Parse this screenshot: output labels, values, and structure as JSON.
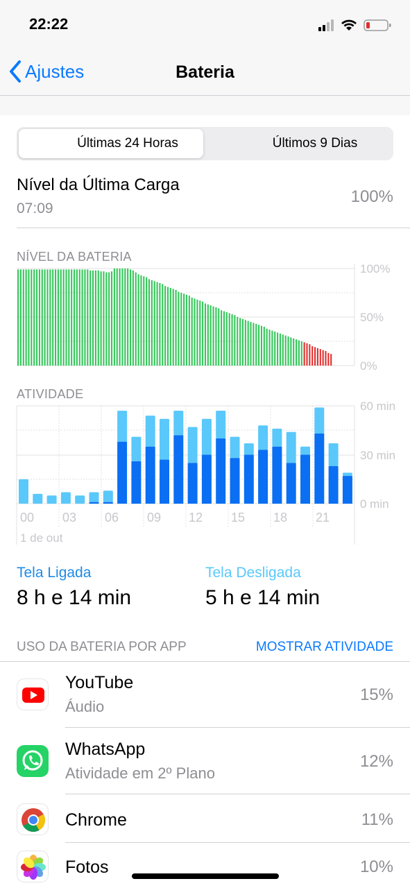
{
  "status_bar": {
    "time": "22:22"
  },
  "nav": {
    "back_label": "Ajustes",
    "title": "Bateria"
  },
  "segment": {
    "options": [
      "Últimas 24 Horas",
      "Últimos 9 Dias"
    ],
    "selected": "Últimas 24 Horas"
  },
  "last_charge": {
    "label": "Nível da Última Carga",
    "time": "07:09",
    "value": "100%"
  },
  "battery_chart": {
    "label": "NÍVEL DA BATERIA",
    "y_ticks": [
      "100%",
      "50%",
      "0%"
    ]
  },
  "activity_chart": {
    "label": "ATIVIDADE",
    "y_ticks": [
      "60 min",
      "30 min",
      "0 min"
    ],
    "x_ticks": [
      "00",
      "03",
      "06",
      "09",
      "12",
      "15",
      "18",
      "21"
    ],
    "date_label": "1 de out"
  },
  "screen_time": {
    "on_label": "Tela Ligada",
    "on_value": "8 h e 14 min",
    "off_label": "Tela Desligada",
    "off_value": "5 h e 14 min"
  },
  "usage": {
    "label": "USO DA BATERIA POR APP",
    "show_activity": "MOSTRAR ATIVIDADE",
    "apps": [
      {
        "name": "YouTube",
        "sub": "Áudio",
        "pct": "15%",
        "icon": "youtube-icon"
      },
      {
        "name": "WhatsApp",
        "sub": "Atividade em 2º Plano",
        "pct": "12%",
        "icon": "whatsapp-icon"
      },
      {
        "name": "Chrome",
        "sub": "",
        "pct": "11%",
        "icon": "chrome-icon"
      },
      {
        "name": "Fotos",
        "sub": "",
        "pct": "10%",
        "icon": "photos-icon"
      }
    ]
  },
  "colors": {
    "accent": "#0a7aff",
    "battery_green": "#34c759",
    "battery_red": "#e0302e",
    "screen_on": "#0a6ff2",
    "screen_off": "#5ac8fa"
  },
  "chart_data": [
    {
      "type": "bar",
      "title": "NÍVEL DA BATERIA",
      "ylim": [
        0,
        100
      ],
      "values": [
        99,
        99,
        99,
        99,
        99,
        99,
        99,
        99,
        99,
        99,
        99,
        99,
        99,
        99,
        99,
        99,
        99,
        99,
        99,
        99,
        99,
        99,
        99,
        99,
        99,
        99,
        99,
        98,
        98,
        98,
        98,
        97,
        97,
        96,
        96,
        97,
        100,
        100,
        100,
        100,
        100,
        100,
        99,
        98,
        96,
        94,
        93,
        92,
        91,
        89,
        88,
        87,
        86,
        85,
        84,
        82,
        81,
        80,
        79,
        78,
        76,
        75,
        74,
        73,
        72,
        70,
        69,
        68,
        67,
        66,
        64,
        63,
        62,
        61,
        60,
        59,
        57,
        56,
        55,
        54,
        53,
        52,
        50,
        49,
        48,
        47,
        46,
        45,
        44,
        43,
        42,
        41,
        40,
        38,
        37,
        36,
        35,
        34,
        33,
        32,
        31,
        30,
        29,
        28,
        27,
        26,
        25,
        24,
        23,
        22,
        20,
        19,
        18,
        17,
        16,
        15,
        13,
        12
      ],
      "red_from_index": 107
    },
    {
      "type": "bar",
      "title": "ATIVIDADE",
      "ylim": [
        0,
        60
      ],
      "categories": [
        "00",
        "01",
        "02",
        "03",
        "04",
        "05",
        "06",
        "07",
        "08",
        "09",
        "10",
        "11",
        "12",
        "13",
        "14",
        "15",
        "16",
        "17",
        "18",
        "19",
        "20",
        "21",
        "22"
      ],
      "series": [
        {
          "name": "Tela Ligada",
          "values": [
            0,
            0,
            0,
            0,
            0,
            1,
            1,
            38,
            26,
            35,
            27,
            42,
            25,
            30,
            40,
            28,
            30,
            33,
            35,
            25,
            30,
            43,
            23,
            17
          ]
        },
        {
          "name": "Tela Desligada",
          "values": [
            15,
            6,
            5,
            7,
            5,
            6,
            7,
            19,
            15,
            19,
            25,
            15,
            22,
            22,
            17,
            13,
            7,
            15,
            11,
            19,
            5,
            16,
            14,
            2
          ]
        }
      ]
    }
  ]
}
